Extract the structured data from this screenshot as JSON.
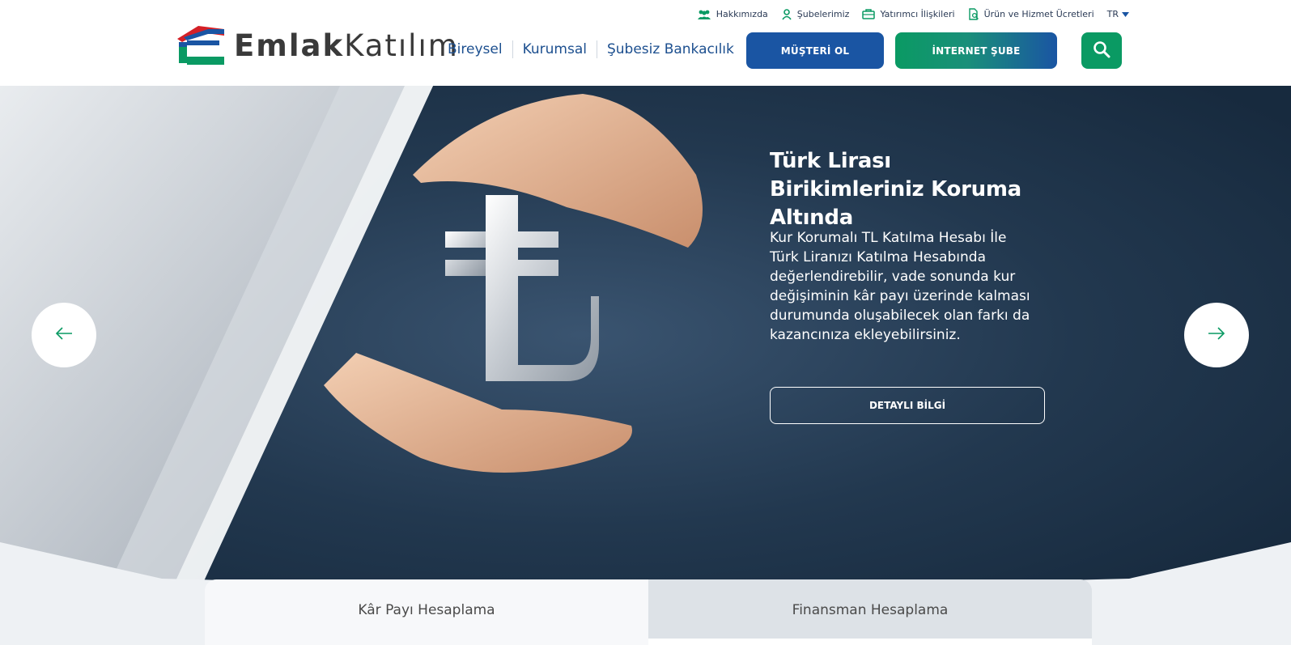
{
  "logo": {
    "bold": "Emlak",
    "light": "Katılım"
  },
  "topbar": {
    "items": [
      {
        "label": "Hakkımızda",
        "icon": "people-icon"
      },
      {
        "label": "Şubelerimiz",
        "icon": "map-pin-person-icon"
      },
      {
        "label": "Yatırımcı İlişkileri",
        "icon": "briefcase-icon"
      },
      {
        "label": "Ürün ve Hizmet Ücretleri",
        "icon": "document-search-icon"
      }
    ],
    "language": "TR"
  },
  "nav": {
    "items": [
      "Bireysel",
      "Kurumsal",
      "Şubesiz Bankacılık"
    ]
  },
  "buttons": {
    "musteri_ol": "MÜŞTERİ OL",
    "internet_sube": "İNTERNET ŞUBE"
  },
  "hero": {
    "title": "Türk Lirası Birikimleriniz Koruma Altında",
    "description": "Kur Korumalı TL Katılma Hesabı İle Türk Liranızı Katılma Hesabında değerlendirebilir, vade sonunda kur değişiminin kâr payı üzerinde kalması durumunda oluşabilecek olan farkı da kazancınıza ekleyebilirsiniz.",
    "cta": "DETAYLI BİLGİ"
  },
  "calculator": {
    "tabs": [
      "Kâr Payı Hesaplama",
      "Finansman Hesaplama"
    ]
  },
  "colors": {
    "brand_blue": "#1a55a3",
    "brand_green": "#0a9a63",
    "nav_blue": "#1c4f8f",
    "hero_dark": "#1b2f45",
    "logo_red": "#d42027"
  }
}
